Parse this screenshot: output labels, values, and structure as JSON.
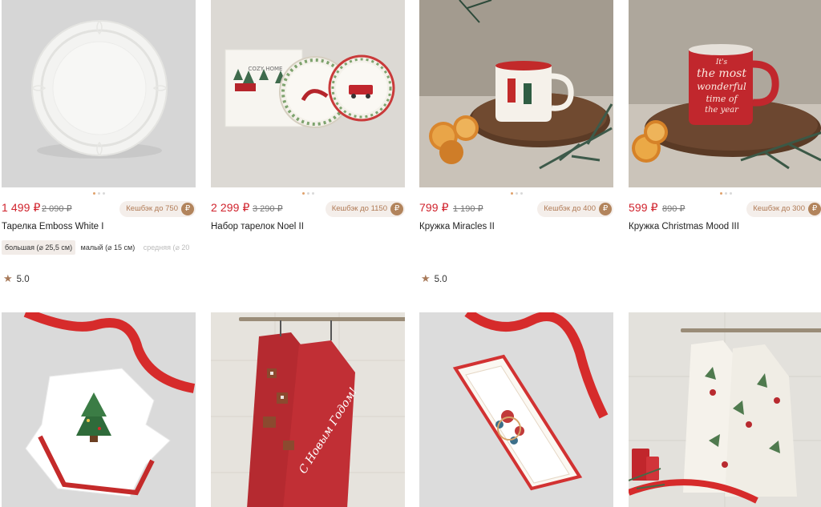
{
  "products": [
    {
      "price": "1 499 ₽",
      "old_price": "2 090 ₽",
      "cashback": "Кешбэк до 750",
      "title": "Тарелка Emboss White I",
      "sizes": [
        "большая (⌀ 25,5 см)",
        "малый (⌀ 15 см)",
        "средняя (⌀ 20"
      ],
      "rating": "5.0"
    },
    {
      "price": "2 299 ₽",
      "old_price": "3 290 ₽",
      "cashback": "Кешбэк до 1150",
      "title": "Набор тарелок Noel II",
      "box_text": "COZY HOME"
    },
    {
      "price": "799 ₽",
      "old_price": "1 190 ₽",
      "cashback": "Кешбэк до 400",
      "title": "Кружка Miracles II",
      "rating": "5.0"
    },
    {
      "price": "599 ₽",
      "old_price": "890 ₽",
      "cashback": "Кешбэк до 300",
      "title": "Кружка Christmas Mood III",
      "mug_text": [
        "It's",
        "the most",
        "wonderful",
        "time of",
        "the year"
      ]
    },
    {
      "title": ""
    },
    {
      "title": "",
      "towel_text": "С Новым Годом!"
    },
    {
      "title": ""
    },
    {
      "title": ""
    }
  ],
  "icons": {
    "cashback": "cashback-coin-icon",
    "rating": "star-icon"
  },
  "colors": {
    "price": "#d0232d",
    "accent": "#b2845c",
    "dot_active": "#e0a16b"
  }
}
